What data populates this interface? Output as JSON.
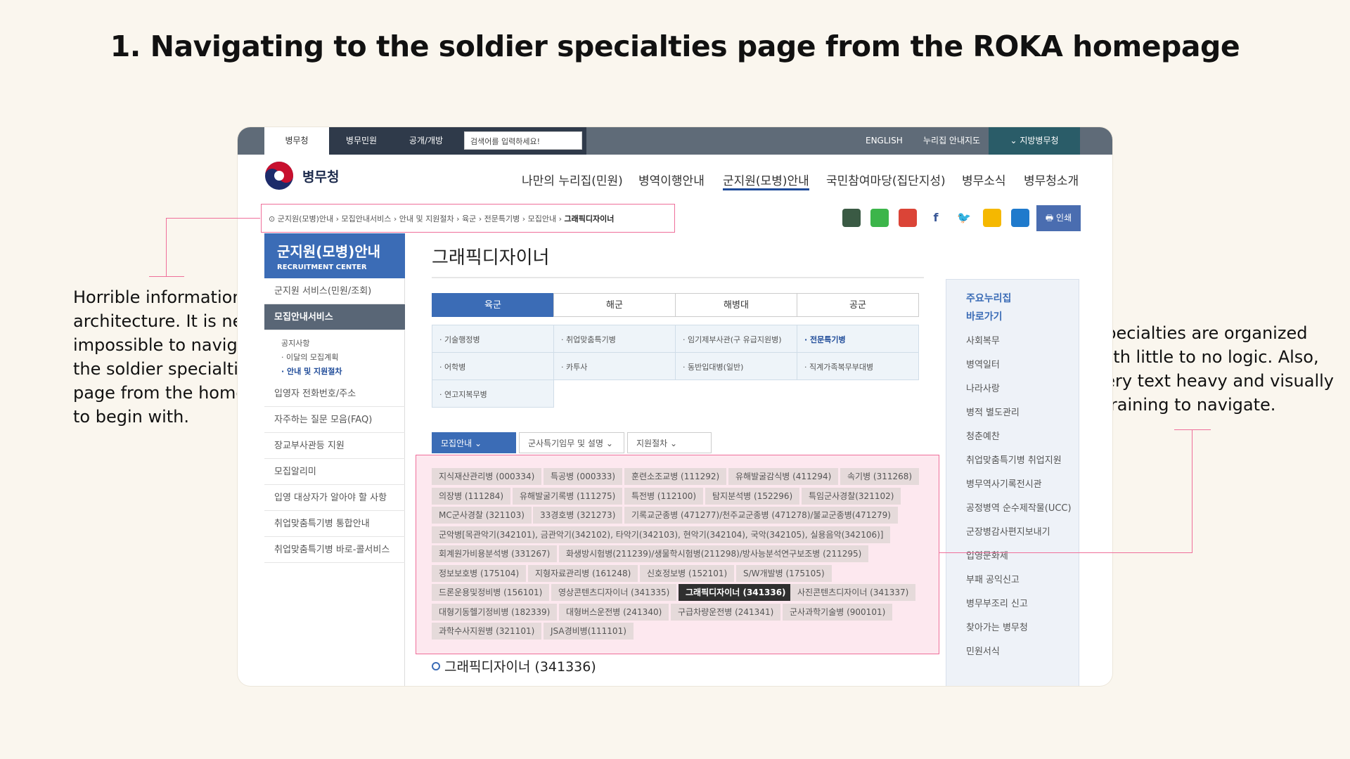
{
  "title": "1. Navigating to the soldier specialties page from the ROKA homepage",
  "notes": {
    "left": "Horrible information architecture. It is near impossible to navigate to the soldier specialties page from the homepage to begin with.",
    "right": "Specialties are organized with little to no logic. Also, very text heavy and visually straining to navigate."
  },
  "topbar": {
    "tabs": [
      "병무청",
      "병무민원",
      "공개/개방"
    ],
    "search_placeholder": "검색어를 입력하세요!",
    "utils": [
      "ENGLISH",
      "누리집 안내지도"
    ],
    "region": "⌄ 지방병무청"
  },
  "logo": "병무청",
  "gnav": [
    "나만의 누리집(민원)",
    "병역이행안내",
    "군지원(모병)안내",
    "국민참여마당(집단지성)",
    "병무소식",
    "병무청소개"
  ],
  "breadcrumb": {
    "path": "군지원(모병)안내 › 모집안내서비스 › 안내 및 지원절차 › 육군 › 전문특기병 › 모집안내 ›",
    "current": "그래픽디자이너"
  },
  "print_label": "인쇄",
  "lnb": {
    "title": "군지원(모병)안내",
    "subtitle": "RECRUITMENT CENTER",
    "items": [
      "군지원 서비스(민원/조회)",
      "모집안내서비스",
      "입영자 전화번호/주소",
      "자주하는 질문 모음(FAQ)",
      "장교부사관등 지원",
      "모집알리미",
      "입영 대상자가 알아야 할 사항",
      "취업맞춤특기병 통합안내",
      "취업맞춤특기병 바로-콜서비스"
    ],
    "subs": [
      "공지사항",
      "· 이달의 모집계획",
      "· 안내 및 지원절차"
    ]
  },
  "content_title": "그래픽디자이너",
  "branches": [
    "육군",
    "해군",
    "해병대",
    "공군"
  ],
  "categories": [
    "· 기술행정병",
    "· 취업맞춤특기병",
    "· 임기제부사관(구 유급지원병)",
    "· 전문특기병",
    "· 어학병",
    "· 카투사",
    "· 동반입대병(일반)",
    "· 직계가족복무부대병",
    "· 연고지복무병"
  ],
  "dropdowns": [
    "모집안내",
    "군사특기임무 및 설명",
    "지원절차"
  ],
  "specialties": [
    [
      "지식재산관리병 (000334)",
      "특공병 (000333)",
      "훈련소조교병 (111292)",
      "유해발굴감식병 (411294)",
      "속기병 (311268)"
    ],
    [
      "의장병 (111284)",
      "유해발굴기록병 (111275)",
      "특전병 (112100)",
      "탐지분석병 (152296)",
      "특임군사경찰(321102)"
    ],
    [
      "MC군사경찰 (321103)",
      "33경호병 (321273)",
      "기록교군종병 (471277)/천주교군종병 (471278)/불교군종병(471279)"
    ],
    [
      "군악병[목관악기(342101), 금관악기(342102), 타악기(342103), 현악기(342104), 국악(342105), 실용음악(342106)]"
    ],
    [
      "회계원가비용분석병 (331267)",
      "화생방시험병(211239)/생물학시험병(211298)/방사능분석연구보조병 (211295)"
    ],
    [
      "정보보호병 (175104)",
      "지형자료관리병 (161248)",
      "신호정보병 (152101)",
      "S/W개발병 (175105)"
    ],
    [
      "드론운용및정비병 (156101)",
      "영상콘텐츠디자이너 (341335)",
      "그래픽디자이너 (341336)",
      "사진콘텐츠디자이너 (341337)"
    ],
    [
      "대형기동헬기정비병 (182339)",
      "대형버스운전병 (241340)",
      "구급차량운전병 (241341)",
      "군사과학기술병 (900101)"
    ],
    [
      "과학수사지원병 (321101)",
      "JSA경비병(111101)"
    ]
  ],
  "selected_specialty": "그래픽디자이너 (341336)",
  "quick": {
    "title": [
      "주요누리집",
      "바로가기"
    ],
    "items": [
      "사회복무",
      "병역일터",
      "나라사랑",
      "병적 별도관리",
      "청춘예찬",
      "취업맞춤특기병 취업지원",
      "병무역사기록전시관",
      "공정병역 순수제작물(UCC)",
      "군장병감사편지보내기",
      "입영문화제",
      "부패 공익신고",
      "병무부조리 신고",
      "찾아가는 병무청",
      "민원서식"
    ]
  },
  "colors": {
    "accent": "#3b6cb6",
    "highlight": "#ef6f9a",
    "background": "#faf6ee"
  }
}
